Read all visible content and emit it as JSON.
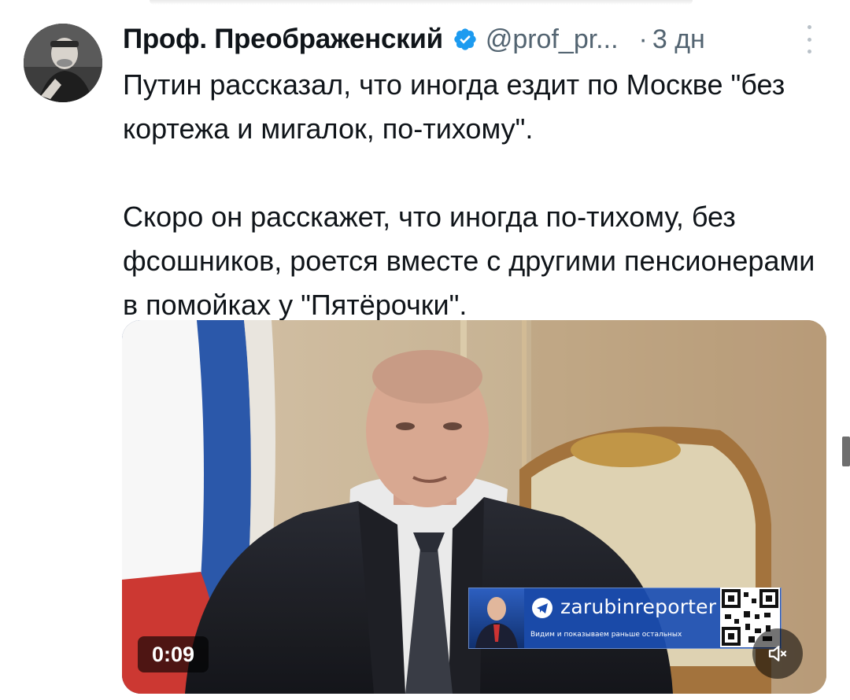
{
  "tweet": {
    "author": {
      "name": "Проф. Преображенский",
      "verified": true,
      "handle": "@prof_pr...",
      "time_separator": "·",
      "time": "3 дн"
    },
    "text": {
      "paragraph_1": "Путин рассказал, что иногда ездит по Москве \"без кортежа и мигалок, по-тихому\".",
      "paragraph_2": "Скоро он расскажет, что иногда по-тихому, без фсошников, роется вместе с другими пенсионерами в помойках у \"Пятёрочки\"."
    },
    "media": {
      "type": "video",
      "duration": "0:09",
      "watermark": {
        "channel": "zarubinreporter",
        "tagline": "Видим и показываем раньше остальных"
      }
    }
  },
  "icons": {
    "verified": "verified-badge-icon",
    "more": "more-options-icon",
    "mute": "speaker-muted-icon",
    "telegram": "telegram-icon"
  },
  "colors": {
    "text_primary": "#0f1419",
    "text_secondary": "#536471",
    "verified_blue": "#1d9bf0",
    "overlay_blue": "#1a4eb4"
  }
}
